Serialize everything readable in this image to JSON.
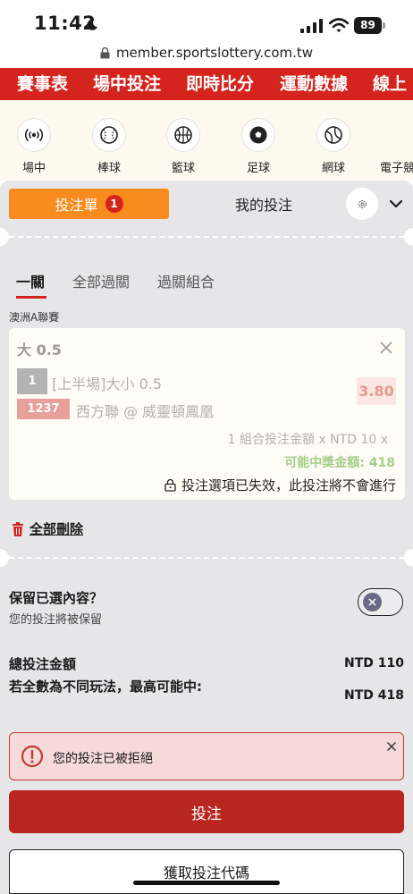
{
  "status_bar": {
    "time": "11:42",
    "battery": "89"
  },
  "browser": {
    "url": "member.sportslottery.com.tw"
  },
  "top_nav": {
    "items": [
      "賽事表",
      "場中投注",
      "即時比分",
      "運動數據",
      "線上"
    ]
  },
  "sports": [
    {
      "label": "場中",
      "icon": "live-broadcast-icon"
    },
    {
      "label": "棒球",
      "icon": "baseball-icon"
    },
    {
      "label": "籃球",
      "icon": "basketball-icon"
    },
    {
      "label": "足球",
      "icon": "soccer-ball-icon"
    },
    {
      "label": "網球",
      "icon": "tennis-ball-icon"
    },
    {
      "label": "電子競",
      "icon": "esports-icon"
    }
  ],
  "betslip": {
    "tab_bet_label": "投注單",
    "tab_bet_count": "1",
    "tab_mybets_label": "我的投注",
    "sub_tabs": [
      "一關",
      "全部過關",
      "過關組合"
    ],
    "league": "澳洲A聯賽",
    "selection": {
      "title": "大 0.5",
      "number": "1",
      "market": "[上半場]大小 0.5",
      "match_number": "1237",
      "match": "西方聯 @ 威靈頓鳳凰",
      "odds": "3.80",
      "stake_text": "1 組合投注金額 x NTD 10 x",
      "payout_text": "可能中獎金額: 418",
      "invalid_text": "投注選項已失效，此投注將不會進行"
    },
    "delete_all_label": "全部刪除",
    "keep_title": "保留已選內容？",
    "keep_subtitle": "您的投注將被保留",
    "keep_toggle_on": false,
    "total_label": "總投注金額",
    "total_value": "NTD 110",
    "max_label": "若全數為不同玩法，最高可能中:",
    "max_value": "NTD 418",
    "alert_text": "您的投注已被拒絕",
    "submit_label": "投注",
    "code_label": "獲取投注代碼"
  },
  "colors": {
    "brand_red": "#d5231d",
    "bet_tab_orange": "#f78b1d",
    "submit_red": "#b9261f",
    "payout_green": "#a5cd8a",
    "alert_bg": "#f6dada"
  }
}
